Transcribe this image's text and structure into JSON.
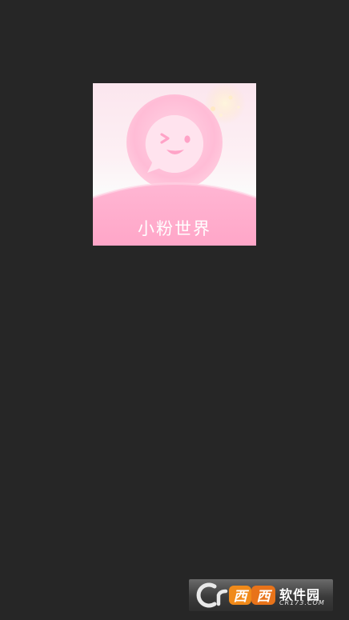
{
  "screen": {
    "background_color": "#262626"
  },
  "app_icon": {
    "name": "小粉世界",
    "accent_color": "#ff9cc6",
    "icon": "smiling-chat-bubble-icon"
  },
  "watermark": {
    "brand": "西西软件园",
    "domain": "CR173.COM",
    "icon": "cr-logo-icon"
  }
}
